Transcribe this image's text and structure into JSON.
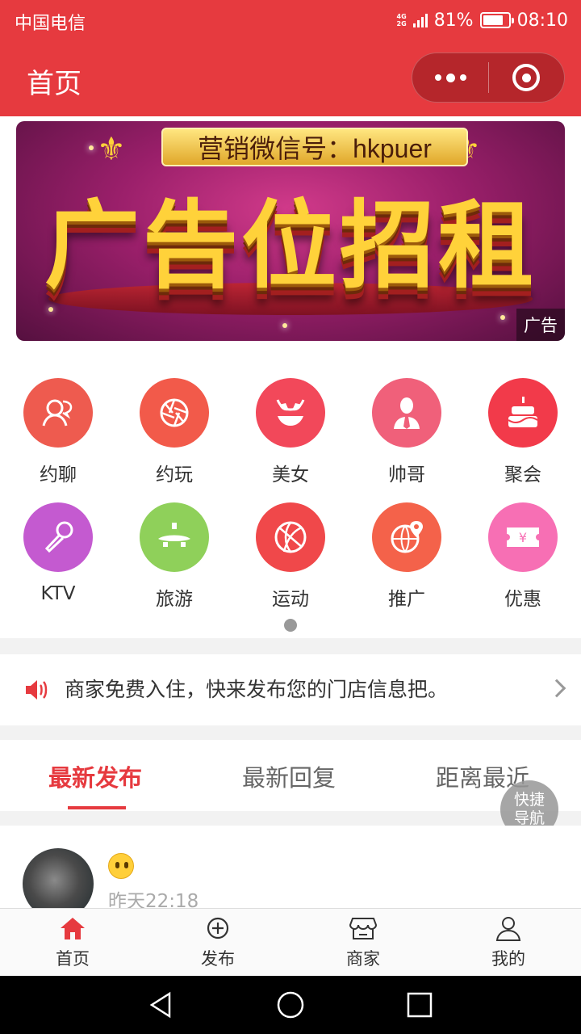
{
  "status_bar": {
    "carrier": "中国电信",
    "network_top": "4G",
    "network_bottom": "2G",
    "battery": "81%",
    "battery_level": 0.81,
    "time": "08:10"
  },
  "header": {
    "title": "首页"
  },
  "banner": {
    "line1": "营销微信号：hkpuer",
    "headline": "广告位招租",
    "ad_tag": "广告"
  },
  "categories": [
    {
      "label": "约聊",
      "color": "#ee5b4f",
      "icon": "chat-person-icon"
    },
    {
      "label": "约玩",
      "color": "#f25a4a",
      "icon": "aperture-icon"
    },
    {
      "label": "美女",
      "color": "#f2485a",
      "icon": "bikini-icon"
    },
    {
      "label": "帅哥",
      "color": "#f0607a",
      "icon": "man-tie-icon"
    },
    {
      "label": "聚会",
      "color": "#f23a4a",
      "icon": "cake-icon"
    },
    {
      "label": "KTV",
      "color": "#c45ad0",
      "icon": "microphone-icon"
    },
    {
      "label": "旅游",
      "color": "#8fd05a",
      "icon": "airplane-icon"
    },
    {
      "label": "运动",
      "color": "#f0484a",
      "icon": "basketball-icon"
    },
    {
      "label": "推广",
      "color": "#f4624a",
      "icon": "globe-pin-icon"
    },
    {
      "label": "优惠",
      "color": "#f76fb4",
      "icon": "ticket-yen-icon"
    }
  ],
  "notice": {
    "text": "商家免费入住，快来发布您的门店信息把。",
    "icon": "speaker-icon"
  },
  "tabs": [
    {
      "label": "最新发布",
      "active": true
    },
    {
      "label": "最新回复",
      "active": false
    },
    {
      "label": "距离最近",
      "active": false
    }
  ],
  "fab": {
    "line1": "快捷",
    "line2": "导航"
  },
  "post": {
    "time": "昨天22:18"
  },
  "tabbar": [
    {
      "label": "首页",
      "icon": "home-icon",
      "active": true
    },
    {
      "label": "发布",
      "icon": "plus-circle-icon",
      "active": false
    },
    {
      "label": "商家",
      "icon": "store-icon",
      "active": false
    },
    {
      "label": "我的",
      "icon": "user-icon",
      "active": false
    }
  ],
  "colors": {
    "brand": "#e63a3f",
    "capsule": "#b5262b"
  }
}
